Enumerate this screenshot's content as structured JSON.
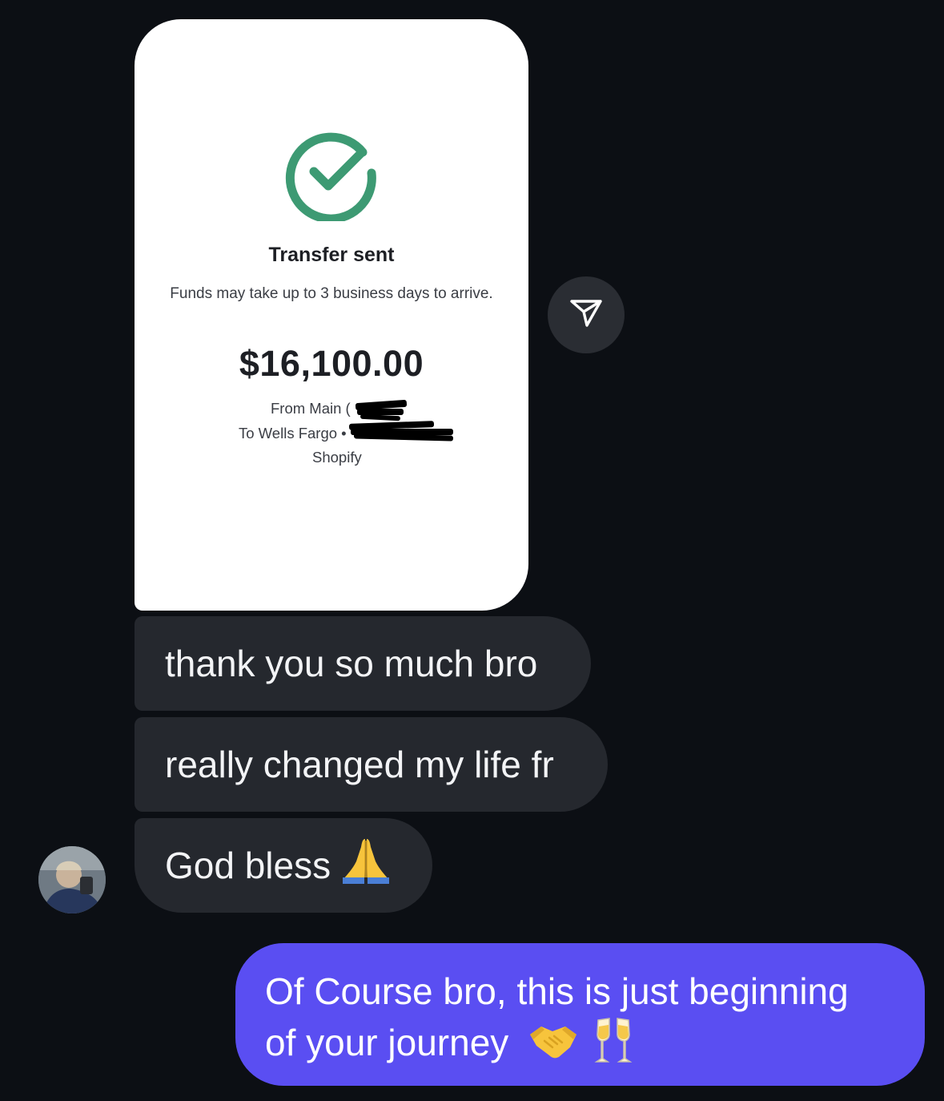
{
  "shared_screenshot": {
    "icon": "check-circle-icon",
    "title": "Transfer sent",
    "subtitle": "Funds may take up to 3 business days to arrive.",
    "amount": "$16,100.00",
    "from_label": "From Main (",
    "to_label": "To Wells Fargo •",
    "merchant": "Shopify",
    "accent_color": "#3d9a73"
  },
  "share_button": {
    "icon": "send-icon"
  },
  "incoming_messages": [
    {
      "text": "thank you so much bro"
    },
    {
      "text": "really changed my life fr"
    },
    {
      "text": "God bless",
      "emoji": "praying-hands-icon"
    }
  ],
  "sender": {
    "avatar": "user-avatar"
  },
  "outgoing_message": {
    "line1": "Of Course bro, this is just beginning",
    "line2": "of your journey",
    "emojis": [
      "handshake-icon",
      "clinking-glasses-icon"
    ],
    "bubble_color": "#5a4ef2"
  }
}
